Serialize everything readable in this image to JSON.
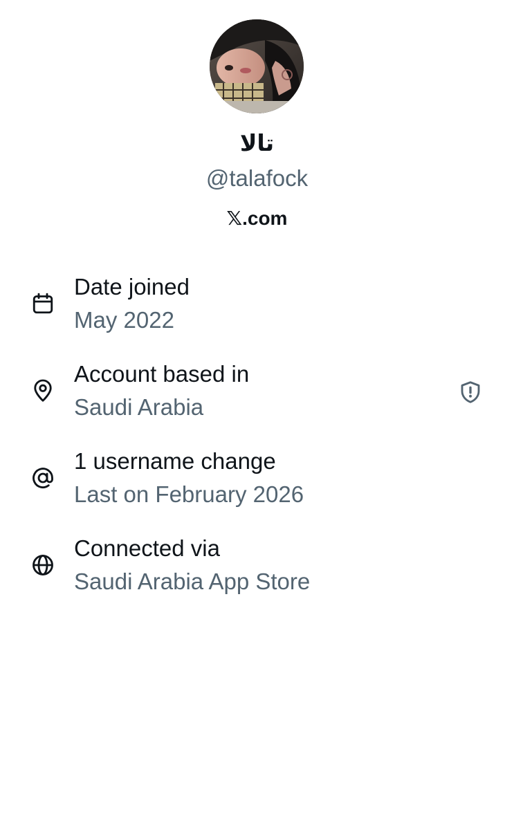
{
  "profile": {
    "display_name": "تالا",
    "handle": "@talafock",
    "site": "𝕏.com",
    "avatar_icon": "profile-photo"
  },
  "details": [
    {
      "icon": "calendar-icon",
      "title": "Date joined",
      "value": "May 2022"
    },
    {
      "icon": "location-pin-icon",
      "title": "Account based in",
      "value": "Saudi Arabia",
      "badge_icon": "shield-alert-icon"
    },
    {
      "icon": "at-sign-icon",
      "title": "1 username change",
      "value": "Last on February 2026"
    },
    {
      "icon": "globe-icon",
      "title": "Connected via",
      "value": "Saudi Arabia App Store"
    }
  ],
  "colors": {
    "primary_text": "#0f1419",
    "secondary_text": "#536471",
    "background": "#ffffff"
  }
}
